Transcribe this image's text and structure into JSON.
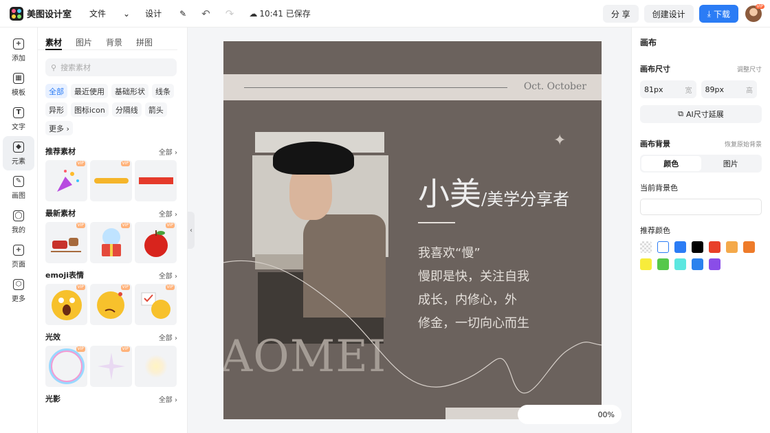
{
  "app": {
    "name": "美图设计室"
  },
  "menu": {
    "file": "文件",
    "design": "设计",
    "save_status": "10:41 已保存"
  },
  "top_actions": {
    "share": "分 享",
    "create": "创建设计",
    "download": "下载",
    "avatar_badge": "VIP"
  },
  "nav": [
    {
      "label": "添加",
      "icon": "plus-icon",
      "glyph": "+"
    },
    {
      "label": "模板",
      "icon": "template-icon",
      "glyph": "▦"
    },
    {
      "label": "文字",
      "icon": "text-icon",
      "glyph": "T"
    },
    {
      "label": "元素",
      "icon": "element-icon",
      "glyph": "◆",
      "active": true
    },
    {
      "label": "画图",
      "icon": "draw-icon",
      "glyph": "✎"
    },
    {
      "label": "我的",
      "icon": "user-icon",
      "glyph": "◯"
    },
    {
      "label": "页面",
      "icon": "page-icon",
      "glyph": "+"
    },
    {
      "label": "更多",
      "icon": "more-icon",
      "glyph": "⬡"
    }
  ],
  "panel": {
    "tabs": [
      "素材",
      "图片",
      "背景",
      "拼图"
    ],
    "search_placeholder": "搜索素材",
    "chips": [
      "全部",
      "最近使用",
      "基础形状",
      "线条",
      "异形",
      "图标icon",
      "分隔线",
      "箭头",
      "更多 ›"
    ],
    "sections": [
      {
        "title": "推荐素材",
        "all": "全部 ›"
      },
      {
        "title": "最新素材",
        "all": "全部 ›"
      },
      {
        "title": "emoji表情",
        "all": "全部 ›"
      },
      {
        "title": "光效",
        "all": "全部 ›"
      },
      {
        "title": "光影",
        "all": "全部 ›"
      }
    ],
    "vip": "VIP"
  },
  "canvas": {
    "date": "Oct. October",
    "title": "小美",
    "subtitle": "/美学分享者",
    "poem": [
      "我喜欢“慢”",
      "慢即是快，关注自我",
      "成长，内修心，外",
      "修金，一切向心而生"
    ],
    "bigword": "AOMEI",
    "zoom": "00%"
  },
  "right": {
    "title": "画布",
    "size_label": "画布尺寸",
    "size_hint": "调整尺寸",
    "width_value": "81px",
    "width_unit": "宽",
    "height_value": "89px",
    "height_unit": "高",
    "ai_button": "AI尺寸延展",
    "bg_label": "画布背景",
    "bg_hint": "恢复原始背景",
    "seg": [
      "颜色",
      "图片"
    ],
    "current_bg": "当前背景色",
    "recommend": "推荐颜色",
    "swatches": [
      "#ffffff",
      "#2b7cf5",
      "#000000",
      "#e8402a",
      "#f4a94a",
      "#ee7b2a",
      "#f7ec3b",
      "#56c84a",
      "#5ce7e0",
      "#2b82ee",
      "#8a4de8"
    ]
  }
}
